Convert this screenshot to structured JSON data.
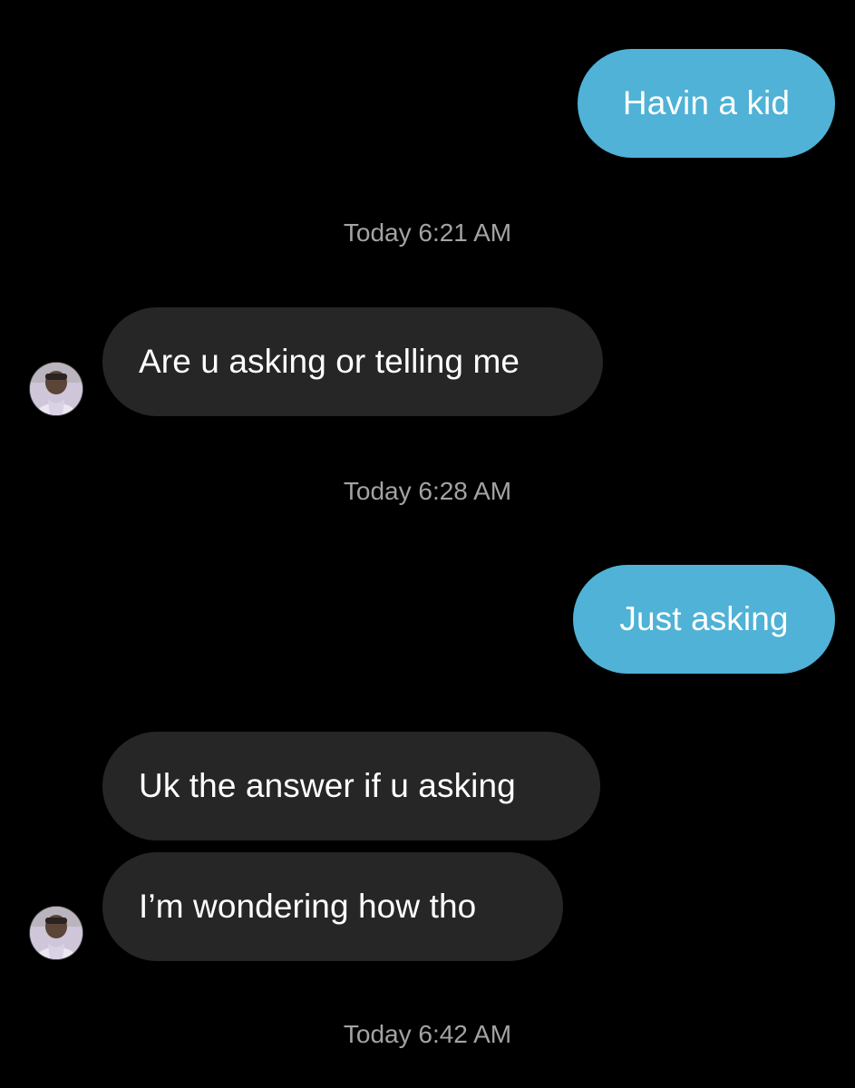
{
  "conversation": {
    "messages": [
      {
        "side": "sent",
        "text": "Havin a kid"
      },
      {
        "side": "timestamp",
        "text": "Today 6:21 AM"
      },
      {
        "side": "received",
        "text": "Are u asking or telling me"
      },
      {
        "side": "timestamp",
        "text": "Today 6:28 AM"
      },
      {
        "side": "sent",
        "text": "Just asking"
      },
      {
        "side": "received",
        "text": "Uk the answer if u asking"
      },
      {
        "side": "received",
        "text": "I’m wondering how tho"
      },
      {
        "side": "timestamp",
        "text": "Today 6:42 AM"
      }
    ]
  },
  "colors": {
    "background": "#000000",
    "sent_bubble": "#4fb2d6",
    "received_bubble": "#262626",
    "timestamp_text": "#a3a3a3"
  },
  "icons": {
    "contact_avatar": "profile-photo-avatar"
  }
}
